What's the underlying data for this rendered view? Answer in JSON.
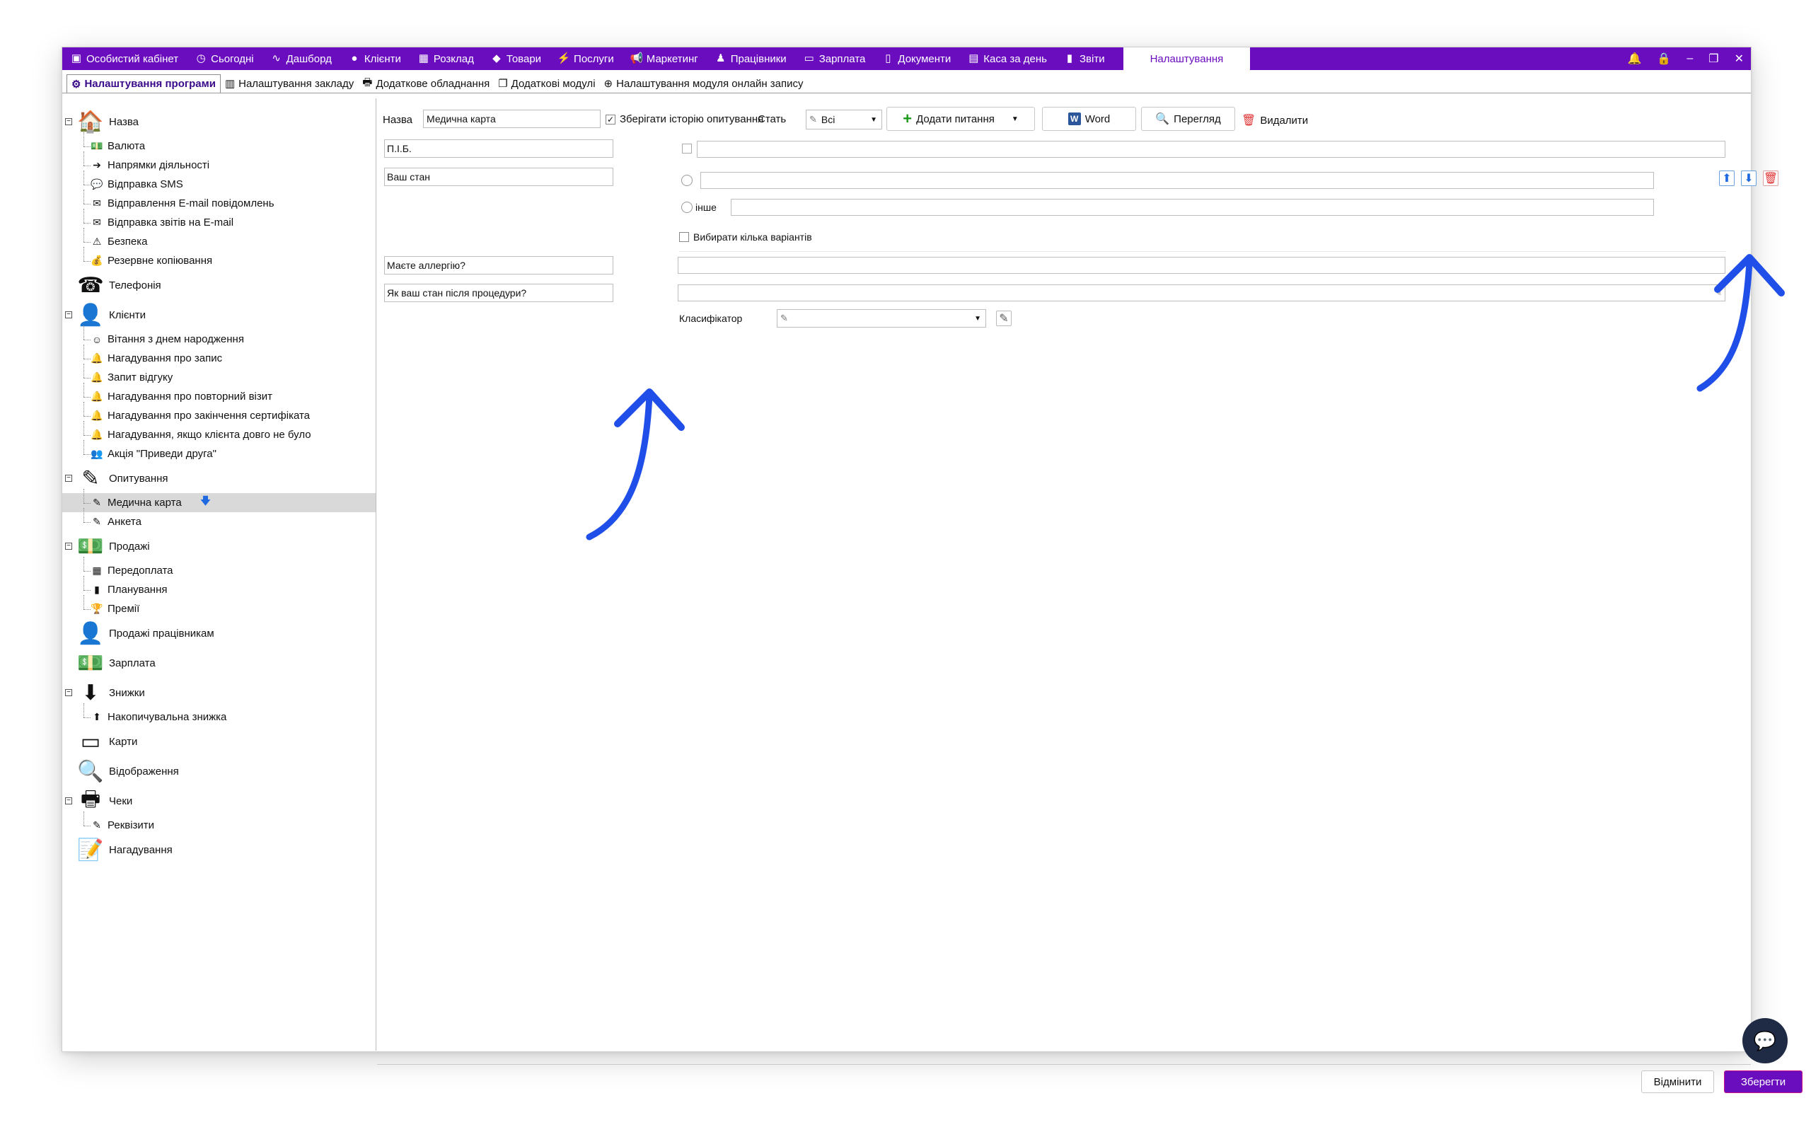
{
  "topnav": {
    "tabs": [
      {
        "label": "Особистий кабінет",
        "icon": "cashbox-icon"
      },
      {
        "label": "Сьогодні",
        "icon": "clock-icon"
      },
      {
        "label": "Дашборд",
        "icon": "pulse-icon"
      },
      {
        "label": "Клієнти",
        "icon": "user-icon"
      },
      {
        "label": "Розклад",
        "icon": "calendar-icon"
      },
      {
        "label": "Товари",
        "icon": "box-icon"
      },
      {
        "label": "Послуги",
        "icon": "lightning-icon"
      },
      {
        "label": "Маркетинг",
        "icon": "megaphone-icon"
      },
      {
        "label": "Працівники",
        "icon": "person-icon"
      },
      {
        "label": "Зарплата",
        "icon": "money-icon"
      },
      {
        "label": "Документи",
        "icon": "document-icon"
      },
      {
        "label": "Каса за день",
        "icon": "calculator-icon"
      },
      {
        "label": "Звіти",
        "icon": "bar-chart-icon"
      }
    ],
    "active_tab": "Налаштування"
  },
  "subtabs": [
    {
      "label": "Налаштування програми",
      "icon": "gear-icon",
      "active": true
    },
    {
      "label": "Налаштування закладу",
      "icon": "building-icon",
      "active": false
    },
    {
      "label": "Додаткове обладнання",
      "icon": "printer-icon",
      "active": false
    },
    {
      "label": "Додаткові модулі",
      "icon": "modules-icon",
      "active": false
    },
    {
      "label": "Налаштування модуля онлайн запису",
      "icon": "globe-icon",
      "active": false
    }
  ],
  "tree": [
    {
      "label": "Назва",
      "icon": "🏠",
      "level": 0,
      "big": true,
      "expander": "−"
    },
    {
      "label": "Валюта",
      "icon": "💵",
      "level": 1
    },
    {
      "label": "Напрямки діяльності",
      "icon": "➔",
      "level": 1
    },
    {
      "label": "Відправка SMS",
      "icon": "💬",
      "level": 1
    },
    {
      "label": "Відправлення E-mail повідомлень",
      "icon": "✉",
      "level": 1
    },
    {
      "label": "Відправка звітів на E-mail",
      "icon": "✉",
      "level": 1
    },
    {
      "label": "Безпека",
      "icon": "⚠",
      "level": 1
    },
    {
      "label": "Резервне копіювання",
      "icon": "💰",
      "level": 1
    },
    {
      "label": "Телефонія",
      "icon": "☎",
      "level": 0,
      "big": true
    },
    {
      "label": "Клієнти",
      "icon": "👤",
      "level": 0,
      "big": true,
      "expander": "−"
    },
    {
      "label": "Вітання з днем народження",
      "icon": "☺",
      "level": 1
    },
    {
      "label": "Нагадування про запис",
      "icon": "🔔",
      "level": 1
    },
    {
      "label": "Запит відгуку",
      "icon": "🔔",
      "level": 1
    },
    {
      "label": "Нагадування про повторний візит",
      "icon": "🔔",
      "level": 1
    },
    {
      "label": "Нагадування про закінчення сертифіката",
      "icon": "🔔",
      "level": 1
    },
    {
      "label": "Нагадування, якщо клієнта довго не було",
      "icon": "🔔",
      "level": 1
    },
    {
      "label": "Акція \"Приведи друга\"",
      "icon": "👥",
      "level": 1
    },
    {
      "label": "Опитування",
      "icon": "✎",
      "level": 0,
      "big": true,
      "expander": "−"
    },
    {
      "label": "Медична карта",
      "icon": "✎",
      "level": 1,
      "selected": true
    },
    {
      "label": "Анкета",
      "icon": "✎",
      "level": 1
    },
    {
      "label": "Продажі",
      "icon": "💵",
      "level": 0,
      "big": true,
      "expander": "−"
    },
    {
      "label": "Передоплата",
      "icon": "▦",
      "level": 1
    },
    {
      "label": "Планування",
      "icon": "▮",
      "level": 1
    },
    {
      "label": "Премії",
      "icon": "🏆",
      "level": 1
    },
    {
      "label": "Продажі працівникам",
      "icon": "👤",
      "level": 0,
      "big": true
    },
    {
      "label": "Зарплата",
      "icon": "💵",
      "level": 0,
      "big": true
    },
    {
      "label": "Знижки",
      "icon": "⬇",
      "level": 0,
      "big": true,
      "expander": "−"
    },
    {
      "label": "Накопичувальна знижка",
      "icon": "⬆",
      "level": 1
    },
    {
      "label": "Карти",
      "icon": "▭",
      "level": 0,
      "big": true
    },
    {
      "label": "Відображення",
      "icon": "🔍",
      "level": 0,
      "big": true
    },
    {
      "label": "Чеки",
      "icon": "🖶",
      "level": 0,
      "big": true,
      "expander": "−"
    },
    {
      "label": "Реквізити",
      "icon": "✎",
      "level": 1
    },
    {
      "label": "Нагадування",
      "icon": "📝",
      "level": 0,
      "big": true
    }
  ],
  "form": {
    "name_label": "Назва",
    "name_value": "Медична карта",
    "save_history_label": "Зберігати історію опитування",
    "save_history_checked": true,
    "gender_label": "Стать",
    "gender_value": "Всі",
    "add_question_label": "Додати питання",
    "word_label": "Word",
    "preview_label": "Перегляд",
    "delete_label": "Видалити",
    "questions": [
      {
        "label": "П.І.Б."
      },
      {
        "label": "Ваш стан",
        "other_option": "інше",
        "multi_label": "Вибирати кілька варіантів"
      },
      {
        "label": "Маєте аллергію?"
      },
      {
        "label": "Як ваш стан після процедури?"
      }
    ],
    "classifier_label": "Класифікатор"
  },
  "footer": {
    "cancel_label": "Відмінити",
    "save_label": "Зберегти"
  },
  "colors": {
    "accent": "#6a0dbf",
    "arrow": "#1f4fe8"
  }
}
